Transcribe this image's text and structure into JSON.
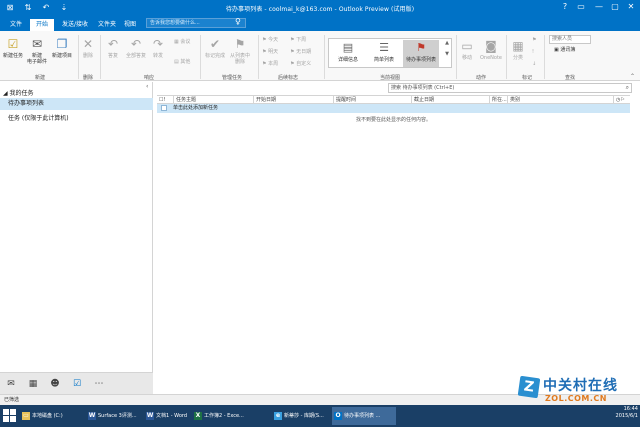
{
  "window": {
    "title": "待办事项列表 - coolmai_k@163.com - Outlook Preview (试用版)",
    "controls": [
      "?",
      "▭",
      "—",
      "▢",
      "✕"
    ]
  },
  "tabs": [
    "文件",
    "开始",
    "发送/接收",
    "文件夹",
    "视图"
  ],
  "active_tab": "开始",
  "tell_me_placeholder": "告诉我您想要做什么...",
  "ribbon": {
    "new": {
      "new_task": "新建任务",
      "new_email": "新建\n电子邮件",
      "new_items": "新建项目",
      "group": "新建"
    },
    "delete": {
      "delete": "删除",
      "group": "删除"
    },
    "respond": {
      "reply": "答复",
      "reply_all": "全部答复",
      "forward": "转发",
      "meeting": "会议",
      "more": "其他",
      "group": "响应"
    },
    "manage": {
      "mark_complete": "标记完成",
      "remove_from_list": "从列表中\n删除",
      "group": "管理任务"
    },
    "followup": {
      "today": "今天",
      "tomorrow": "明天",
      "this_week": "本周",
      "next_week": "下周",
      "no_date": "无日期",
      "custom": "自定义",
      "group": "后续标志"
    },
    "current_view": {
      "detailed": "详细信息",
      "simple_list": "简单列表",
      "todo_list": "待办事项列表",
      "group": "当前视图"
    },
    "actions": {
      "move": "移动",
      "onenote": "OneNote",
      "group": "动作"
    },
    "tags": {
      "categorize": "分类",
      "group": "标记"
    },
    "find": {
      "search_people": "搜索人员",
      "address_book": "通讯簿",
      "group": "查找"
    }
  },
  "search": {
    "placeholder": "搜索 待办事项列表 (Ctrl+E)"
  },
  "nav": {
    "header": "◢ 我的任务",
    "selected": "待办事项列表",
    "item": "任务 (仅限于此计算机)"
  },
  "columns": [
    "任务主题",
    "开始日期",
    "提醒时间",
    "截止日期",
    "所在...",
    "类别"
  ],
  "new_task_row": "单击此处添加新任务",
  "empty_message": "找不到要在此处显示的任何内容。",
  "statusbar": "已筛选",
  "taskbar": {
    "items": [
      {
        "label": "本地磁盘 (C:)",
        "icon": "folder-icon",
        "color": "#e8c25a"
      },
      {
        "label": "Surface 3评测...",
        "icon": "word-icon",
        "color": "#2b5797"
      },
      {
        "label": "文档1 - Word ...",
        "icon": "word-icon",
        "color": "#2b5797"
      },
      {
        "label": "工作簿2 - Exce...",
        "icon": "excel-icon",
        "color": "#1e7145"
      },
      {
        "label": "新蒂莎 - 库期(S...",
        "icon": "ie-icon",
        "color": "#3aa0e0"
      },
      {
        "label": "待办事项列表 ...",
        "icon": "outlook-icon",
        "color": "#0072c6"
      }
    ],
    "clock": {
      "time": "16:44",
      "date": "2015/6/1"
    }
  },
  "watermark": {
    "brand": "中关村在线",
    "url": "ZOL.COM.CN"
  }
}
